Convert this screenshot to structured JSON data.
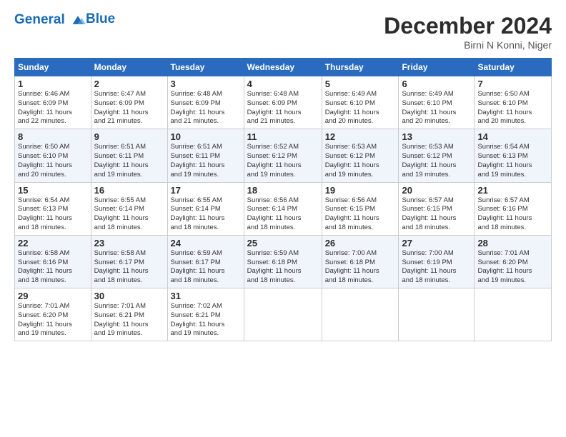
{
  "header": {
    "logo_line1": "General",
    "logo_line2": "Blue",
    "month_title": "December 2024",
    "location": "Birni N Konni, Niger"
  },
  "weekdays": [
    "Sunday",
    "Monday",
    "Tuesday",
    "Wednesday",
    "Thursday",
    "Friday",
    "Saturday"
  ],
  "weeks": [
    [
      {
        "day": "1",
        "info": "Sunrise: 6:46 AM\nSunset: 6:09 PM\nDaylight: 11 hours\nand 22 minutes."
      },
      {
        "day": "2",
        "info": "Sunrise: 6:47 AM\nSunset: 6:09 PM\nDaylight: 11 hours\nand 21 minutes."
      },
      {
        "day": "3",
        "info": "Sunrise: 6:48 AM\nSunset: 6:09 PM\nDaylight: 11 hours\nand 21 minutes."
      },
      {
        "day": "4",
        "info": "Sunrise: 6:48 AM\nSunset: 6:09 PM\nDaylight: 11 hours\nand 21 minutes."
      },
      {
        "day": "5",
        "info": "Sunrise: 6:49 AM\nSunset: 6:10 PM\nDaylight: 11 hours\nand 20 minutes."
      },
      {
        "day": "6",
        "info": "Sunrise: 6:49 AM\nSunset: 6:10 PM\nDaylight: 11 hours\nand 20 minutes."
      },
      {
        "day": "7",
        "info": "Sunrise: 6:50 AM\nSunset: 6:10 PM\nDaylight: 11 hours\nand 20 minutes."
      }
    ],
    [
      {
        "day": "8",
        "info": "Sunrise: 6:50 AM\nSunset: 6:10 PM\nDaylight: 11 hours\nand 20 minutes."
      },
      {
        "day": "9",
        "info": "Sunrise: 6:51 AM\nSunset: 6:11 PM\nDaylight: 11 hours\nand 19 minutes."
      },
      {
        "day": "10",
        "info": "Sunrise: 6:51 AM\nSunset: 6:11 PM\nDaylight: 11 hours\nand 19 minutes."
      },
      {
        "day": "11",
        "info": "Sunrise: 6:52 AM\nSunset: 6:12 PM\nDaylight: 11 hours\nand 19 minutes."
      },
      {
        "day": "12",
        "info": "Sunrise: 6:53 AM\nSunset: 6:12 PM\nDaylight: 11 hours\nand 19 minutes."
      },
      {
        "day": "13",
        "info": "Sunrise: 6:53 AM\nSunset: 6:12 PM\nDaylight: 11 hours\nand 19 minutes."
      },
      {
        "day": "14",
        "info": "Sunrise: 6:54 AM\nSunset: 6:13 PM\nDaylight: 11 hours\nand 19 minutes."
      }
    ],
    [
      {
        "day": "15",
        "info": "Sunrise: 6:54 AM\nSunset: 6:13 PM\nDaylight: 11 hours\nand 18 minutes."
      },
      {
        "day": "16",
        "info": "Sunrise: 6:55 AM\nSunset: 6:14 PM\nDaylight: 11 hours\nand 18 minutes."
      },
      {
        "day": "17",
        "info": "Sunrise: 6:55 AM\nSunset: 6:14 PM\nDaylight: 11 hours\nand 18 minutes."
      },
      {
        "day": "18",
        "info": "Sunrise: 6:56 AM\nSunset: 6:14 PM\nDaylight: 11 hours\nand 18 minutes."
      },
      {
        "day": "19",
        "info": "Sunrise: 6:56 AM\nSunset: 6:15 PM\nDaylight: 11 hours\nand 18 minutes."
      },
      {
        "day": "20",
        "info": "Sunrise: 6:57 AM\nSunset: 6:15 PM\nDaylight: 11 hours\nand 18 minutes."
      },
      {
        "day": "21",
        "info": "Sunrise: 6:57 AM\nSunset: 6:16 PM\nDaylight: 11 hours\nand 18 minutes."
      }
    ],
    [
      {
        "day": "22",
        "info": "Sunrise: 6:58 AM\nSunset: 6:16 PM\nDaylight: 11 hours\nand 18 minutes."
      },
      {
        "day": "23",
        "info": "Sunrise: 6:58 AM\nSunset: 6:17 PM\nDaylight: 11 hours\nand 18 minutes."
      },
      {
        "day": "24",
        "info": "Sunrise: 6:59 AM\nSunset: 6:17 PM\nDaylight: 11 hours\nand 18 minutes."
      },
      {
        "day": "25",
        "info": "Sunrise: 6:59 AM\nSunset: 6:18 PM\nDaylight: 11 hours\nand 18 minutes."
      },
      {
        "day": "26",
        "info": "Sunrise: 7:00 AM\nSunset: 6:18 PM\nDaylight: 11 hours\nand 18 minutes."
      },
      {
        "day": "27",
        "info": "Sunrise: 7:00 AM\nSunset: 6:19 PM\nDaylight: 11 hours\nand 18 minutes."
      },
      {
        "day": "28",
        "info": "Sunrise: 7:01 AM\nSunset: 6:20 PM\nDaylight: 11 hours\nand 19 minutes."
      }
    ],
    [
      {
        "day": "29",
        "info": "Sunrise: 7:01 AM\nSunset: 6:20 PM\nDaylight: 11 hours\nand 19 minutes."
      },
      {
        "day": "30",
        "info": "Sunrise: 7:01 AM\nSunset: 6:21 PM\nDaylight: 11 hours\nand 19 minutes."
      },
      {
        "day": "31",
        "info": "Sunrise: 7:02 AM\nSunset: 6:21 PM\nDaylight: 11 hours\nand 19 minutes."
      },
      null,
      null,
      null,
      null
    ]
  ]
}
